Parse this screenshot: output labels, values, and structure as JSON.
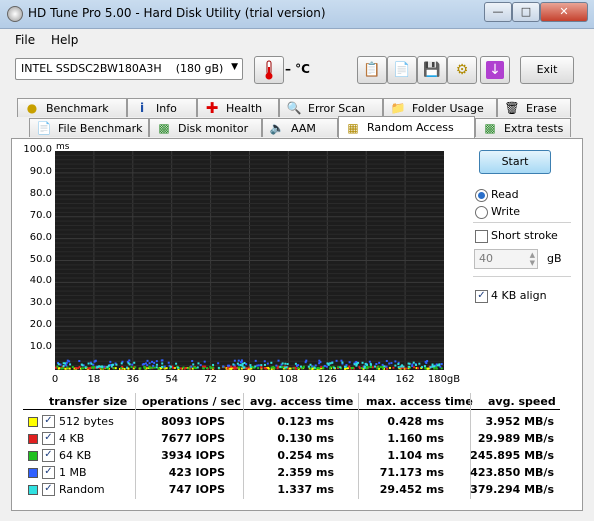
{
  "window": {
    "title": "HD Tune Pro 5.00 - Hard Disk Utility (trial version)",
    "minimize_icon": "minimize-icon",
    "maximize_icon": "maximize-icon",
    "close_icon": "close-icon"
  },
  "menu": {
    "file": "File",
    "help": "Help"
  },
  "toolbar": {
    "drive_name": "INTEL SSDSC2BW180A3H",
    "drive_size": "(180 gB)",
    "temperature": "– °C",
    "exit_label": "Exit",
    "icons": [
      "copy-text-icon",
      "copy-screenshot-icon",
      "save-icon",
      "options-icon",
      "download-icon"
    ]
  },
  "tabs_row1": [
    {
      "label": "Benchmark",
      "icon": "benchmark-icon"
    },
    {
      "label": "Info",
      "icon": "info-icon"
    },
    {
      "label": "Health",
      "icon": "health-icon"
    },
    {
      "label": "Error Scan",
      "icon": "error-scan-icon"
    },
    {
      "label": "Folder Usage",
      "icon": "folder-icon"
    },
    {
      "label": "Erase",
      "icon": "erase-icon"
    }
  ],
  "tabs_row2": [
    {
      "label": "File Benchmark",
      "icon": "file-benchmark-icon"
    },
    {
      "label": "Disk monitor",
      "icon": "disk-monitor-icon"
    },
    {
      "label": "AAM",
      "icon": "aam-icon"
    },
    {
      "label": "Random Access",
      "icon": "random-access-icon",
      "active": true
    },
    {
      "label": "Extra tests",
      "icon": "extra-tests-icon"
    }
  ],
  "chart": {
    "y_unit": "ms",
    "y_ticks": [
      "100.0",
      "90.0",
      "80.0",
      "70.0",
      "60.0",
      "50.0",
      "40.0",
      "30.0",
      "20.0",
      "10.0"
    ],
    "x_ticks": [
      "0",
      "18",
      "36",
      "54",
      "72",
      "90",
      "108",
      "126",
      "144",
      "162",
      "180gB"
    ]
  },
  "chart_data": {
    "type": "scatter",
    "ylabel": "ms",
    "xlabel": "",
    "xlim": [
      0,
      180
    ],
    "ylim": [
      0,
      100
    ],
    "grid": true,
    "background": "#1d1d1d",
    "series": [
      {
        "name": "512 bytes",
        "color": "#ffff00",
        "y_range": [
          0.0,
          0.5
        ]
      },
      {
        "name": "4 KB",
        "color": "#e02020",
        "y_range": [
          0.1,
          1.2
        ]
      },
      {
        "name": "64 KB",
        "color": "#20c020",
        "y_range": [
          0.2,
          1.1
        ]
      },
      {
        "name": "1 MB",
        "color": "#3060ff",
        "y_range": [
          1.0,
          4.0
        ]
      },
      {
        "name": "Random",
        "color": "#30e0e0",
        "y_range": [
          0.5,
          3.0
        ]
      }
    ]
  },
  "controls": {
    "start_label": "Start",
    "read_label": "Read",
    "write_label": "Write",
    "short_stroke_label": "Short stroke",
    "short_stroke_value": "40",
    "short_stroke_unit": "gB",
    "align_label": "4 KB align"
  },
  "table": {
    "headers": [
      "transfer size",
      "operations / sec",
      "avg. access time",
      "max. access time",
      "avg. speed"
    ],
    "rows": [
      {
        "name": "512 bytes",
        "color": "#ffff00",
        "ops": "8093 IOPS",
        "avg": "0.123 ms",
        "max": "0.428 ms",
        "speed": "3.952 MB/s"
      },
      {
        "name": "4 KB",
        "color": "#e02020",
        "ops": "7677 IOPS",
        "avg": "0.130 ms",
        "max": "1.160 ms",
        "speed": "29.989 MB/s"
      },
      {
        "name": "64 KB",
        "color": "#20c020",
        "ops": "3934 IOPS",
        "avg": "0.254 ms",
        "max": "1.104 ms",
        "speed": "245.895 MB/s"
      },
      {
        "name": "1 MB",
        "color": "#3060ff",
        "ops": "423 IOPS",
        "avg": "2.359 ms",
        "max": "71.173 ms",
        "speed": "423.850 MB/s"
      },
      {
        "name": "Random",
        "color": "#30e0e0",
        "ops": "747 IOPS",
        "avg": "1.337 ms",
        "max": "29.452 ms",
        "speed": "379.294 MB/s"
      }
    ]
  }
}
